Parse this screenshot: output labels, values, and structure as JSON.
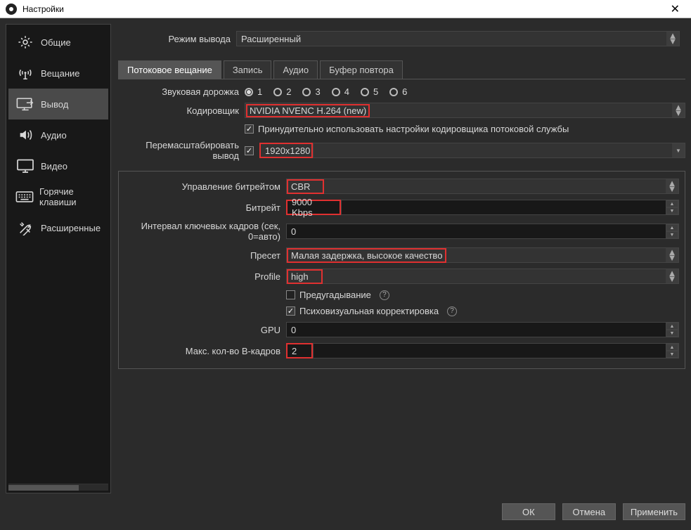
{
  "window": {
    "title": "Настройки"
  },
  "sidebar": {
    "items": [
      {
        "label": "Общие"
      },
      {
        "label": "Вещание"
      },
      {
        "label": "Вывод"
      },
      {
        "label": "Аудио"
      },
      {
        "label": "Видео"
      },
      {
        "label": "Горячие клавиши"
      },
      {
        "label": "Расширенные"
      }
    ]
  },
  "mode_row": {
    "label": "Режим вывода",
    "value": "Расширенный"
  },
  "tabs": [
    {
      "label": "Потоковое вещание"
    },
    {
      "label": "Запись"
    },
    {
      "label": "Аудио"
    },
    {
      "label": "Буфер повтора"
    }
  ],
  "audio_track": {
    "label": "Звуковая дорожка",
    "options": [
      "1",
      "2",
      "3",
      "4",
      "5",
      "6"
    ],
    "selected": "1"
  },
  "encoder": {
    "label": "Кодировщик",
    "value": "NVIDIA NVENC H.264 (new)"
  },
  "enforce": {
    "checked": true,
    "label": "Принудительно использовать настройки кодировщика потоковой службы"
  },
  "rescale": {
    "label": "Перемасштабировать вывод",
    "checked": true,
    "value": "1920x1280"
  },
  "section": {
    "rate_control": {
      "label": "Управление битрейтом",
      "value": "CBR"
    },
    "bitrate": {
      "label": "Битрейт",
      "value": "9000 Kbps"
    },
    "keyint": {
      "label": "Интервал ключевых кадров (сек, 0=авто)",
      "value": "0"
    },
    "preset": {
      "label": "Пресет",
      "value": "Малая задержка, высокое качество"
    },
    "profile": {
      "label": "Profile",
      "value": "high"
    },
    "lookahead": {
      "label": "Предугадывание",
      "checked": false
    },
    "psycho": {
      "label": "Психовизуальная корректировка",
      "checked": true
    },
    "gpu": {
      "label": "GPU",
      "value": "0"
    },
    "bframes": {
      "label": "Макс. кол-во B-кадров",
      "value": "2"
    }
  },
  "footer": {
    "ok": "ОК",
    "cancel": "Отмена",
    "apply": "Применить"
  }
}
